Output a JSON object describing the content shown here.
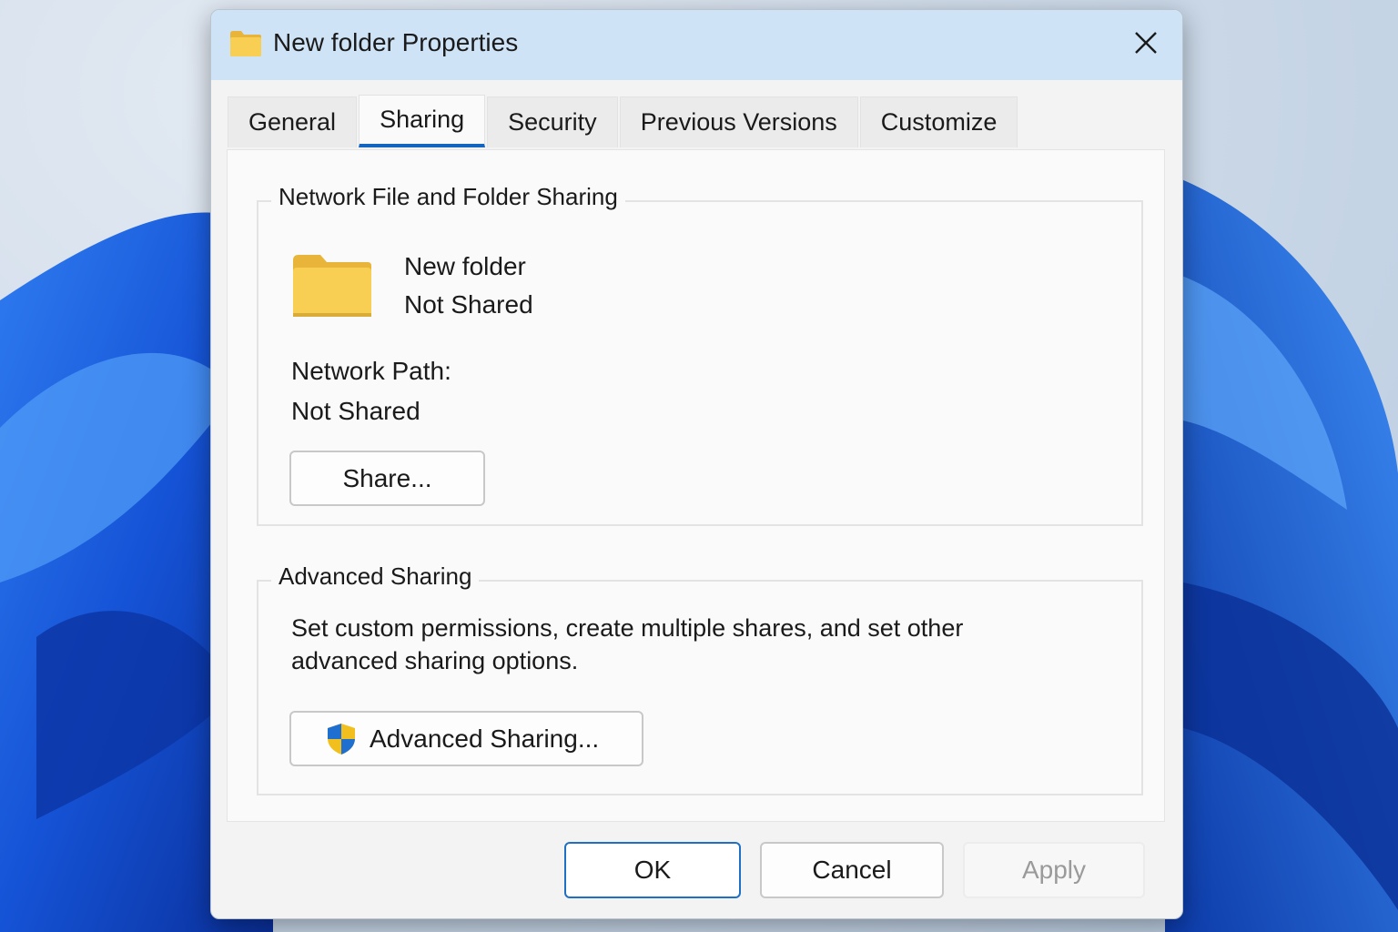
{
  "window": {
    "title": "New folder Properties",
    "close_icon": "close-icon"
  },
  "tabs": [
    {
      "label": "General"
    },
    {
      "label": "Sharing",
      "active": true
    },
    {
      "label": "Security"
    },
    {
      "label": "Previous Versions"
    },
    {
      "label": "Customize"
    }
  ],
  "network_sharing": {
    "group_title": "Network File and Folder Sharing",
    "folder_name": "New folder",
    "folder_status": "Not Shared",
    "path_label": "Network Path:",
    "path_value": "Not Shared",
    "share_button": "Share..."
  },
  "advanced_sharing": {
    "group_title": "Advanced Sharing",
    "description_line1": "Set custom permissions, create multiple shares, and set other",
    "description_line2": "advanced sharing options.",
    "button_label": "Advanced Sharing...",
    "button_icon": "uac-shield-icon"
  },
  "footer": {
    "ok": "OK",
    "cancel": "Cancel",
    "apply": "Apply"
  },
  "colors": {
    "titlebar": "#cfe3f7",
    "accent": "#1565c0",
    "folder": "#f8cf52"
  }
}
